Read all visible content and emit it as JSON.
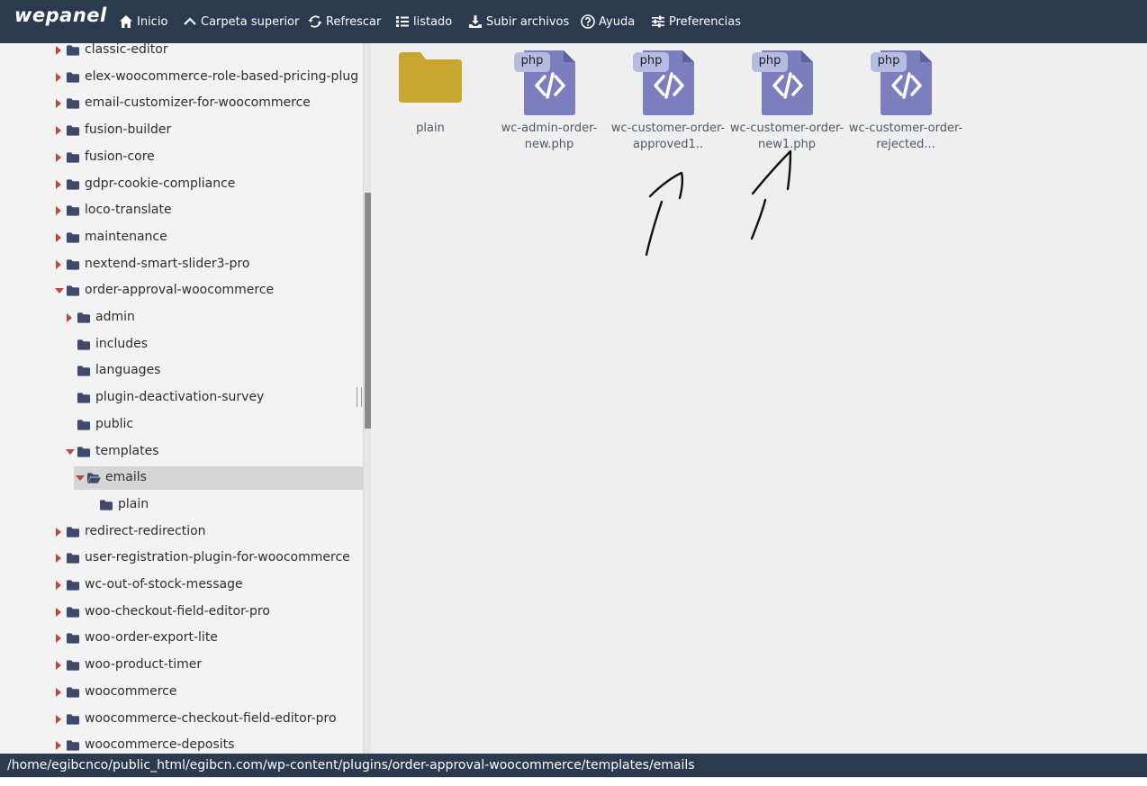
{
  "app": {
    "logo": "wepanel"
  },
  "toolbar": {
    "home": "Inicio",
    "parent": "Carpeta superior",
    "refresh": "Refrescar",
    "list": "listado",
    "upload": "Subir archivos",
    "help": "Ayuda",
    "prefs": "Preferencias"
  },
  "tree": [
    {
      "label": "classic-editor",
      "state": "closed",
      "depth": 0
    },
    {
      "label": "elex-woocommerce-role-based-pricing-plug",
      "state": "closed",
      "depth": 0
    },
    {
      "label": "email-customizer-for-woocommerce",
      "state": "closed",
      "depth": 0
    },
    {
      "label": "fusion-builder",
      "state": "closed",
      "depth": 0
    },
    {
      "label": "fusion-core",
      "state": "closed",
      "depth": 0
    },
    {
      "label": "gdpr-cookie-compliance",
      "state": "closed",
      "depth": 0
    },
    {
      "label": "loco-translate",
      "state": "closed",
      "depth": 0
    },
    {
      "label": "maintenance",
      "state": "closed",
      "depth": 0
    },
    {
      "label": "nextend-smart-slider3-pro",
      "state": "closed",
      "depth": 0
    },
    {
      "label": "order-approval-woocommerce",
      "state": "open",
      "depth": 0
    },
    {
      "label": "admin",
      "state": "closed",
      "depth": 1
    },
    {
      "label": "includes",
      "state": "none",
      "depth": 1
    },
    {
      "label": "languages",
      "state": "none",
      "depth": 1
    },
    {
      "label": "plugin-deactivation-survey",
      "state": "none",
      "depth": 1
    },
    {
      "label": "public",
      "state": "none",
      "depth": 1
    },
    {
      "label": "templates",
      "state": "open",
      "depth": 1
    },
    {
      "label": "emails",
      "state": "open",
      "depth": 2,
      "selected": true
    },
    {
      "label": "plain",
      "state": "none",
      "depth": 3
    },
    {
      "label": "redirect-redirection",
      "state": "closed",
      "depth": 0
    },
    {
      "label": "user-registration-plugin-for-woocommerce",
      "state": "closed",
      "depth": 0
    },
    {
      "label": "wc-out-of-stock-message",
      "state": "closed",
      "depth": 0
    },
    {
      "label": "woo-checkout-field-editor-pro",
      "state": "closed",
      "depth": 0
    },
    {
      "label": "woo-order-export-lite",
      "state": "closed",
      "depth": 0
    },
    {
      "label": "woo-product-timer",
      "state": "closed",
      "depth": 0
    },
    {
      "label": "woocommerce",
      "state": "closed",
      "depth": 0
    },
    {
      "label": "woocommerce-checkout-field-editor-pro",
      "state": "closed",
      "depth": 0
    },
    {
      "label": "woocommerce-deposits",
      "state": "closed",
      "depth": 0
    }
  ],
  "files": [
    {
      "type": "folder",
      "name": "plain"
    },
    {
      "type": "php",
      "badge": "php",
      "name": "wc-admin-order-new.php"
    },
    {
      "type": "php",
      "badge": "php",
      "name": "wc-customer-order-approved1.."
    },
    {
      "type": "php",
      "badge": "php",
      "name": "wc-customer-order-new1.php"
    },
    {
      "type": "php",
      "badge": "php",
      "name": "wc-customer-order-rejected..."
    }
  ],
  "status": {
    "path": "/home/egibcnco/public_html/egibcn.com/wp-content/plugins/order-approval-woocommerce/templates/emails"
  },
  "colors": {
    "topbar": "#2c3a4f",
    "folder_tree": "#3d4a6b",
    "folder_main": "#c9a630",
    "php_icon": "#7b7fbe",
    "php_badge": "#b4bde0",
    "twisty": "#c0463e"
  }
}
